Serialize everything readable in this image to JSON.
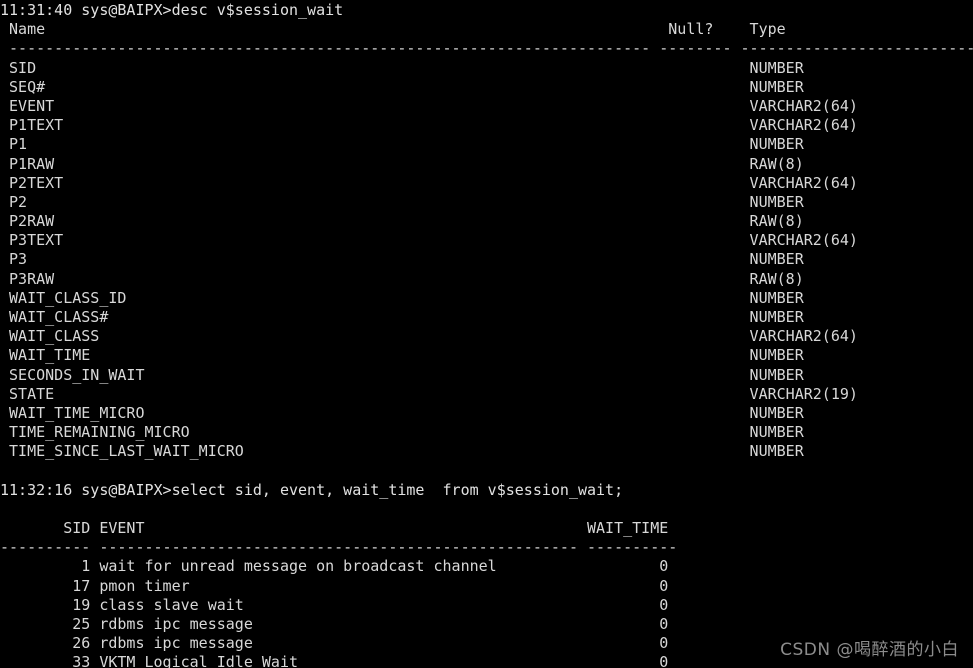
{
  "terminal": {
    "background_color": "#000000",
    "foreground_color": "#d8d8d8",
    "watermark": "CSDN @喝醉酒的小白"
  },
  "session": {
    "prompt_1": "11:31:40 sys@BAIPX>desc v$session_wait",
    "prompt_2": "11:32:16 sys@BAIPX>select sid, event, wait_time  from v$session_wait;",
    "timestamps": [
      "11:31:40",
      "11:32:16"
    ],
    "user_host": "sys@BAIPX",
    "commands": [
      "desc v$session_wait",
      "select sid, event, wait_time  from v$session_wait;"
    ]
  },
  "describe_table": {
    "headers": [
      " Name",
      "Null?",
      "Type"
    ],
    "header_line": " Name                                                                     Null?    Type",
    "separator_line": " ----------------------------------------------------------------------- -------- -----------------------------",
    "columns": [
      {
        "name": "SID",
        "null": "",
        "type": "NUMBER"
      },
      {
        "name": "SEQ#",
        "null": "",
        "type": "NUMBER"
      },
      {
        "name": "EVENT",
        "null": "",
        "type": "VARCHAR2(64)"
      },
      {
        "name": "P1TEXT",
        "null": "",
        "type": "VARCHAR2(64)"
      },
      {
        "name": "P1",
        "null": "",
        "type": "NUMBER"
      },
      {
        "name": "P1RAW",
        "null": "",
        "type": "RAW(8)"
      },
      {
        "name": "P2TEXT",
        "null": "",
        "type": "VARCHAR2(64)"
      },
      {
        "name": "P2",
        "null": "",
        "type": "NUMBER"
      },
      {
        "name": "P2RAW",
        "null": "",
        "type": "RAW(8)"
      },
      {
        "name": "P3TEXT",
        "null": "",
        "type": "VARCHAR2(64)"
      },
      {
        "name": "P3",
        "null": "",
        "type": "NUMBER"
      },
      {
        "name": "P3RAW",
        "null": "",
        "type": "RAW(8)"
      },
      {
        "name": "WAIT_CLASS_ID",
        "null": "",
        "type": "NUMBER"
      },
      {
        "name": "WAIT_CLASS#",
        "null": "",
        "type": "NUMBER"
      },
      {
        "name": "WAIT_CLASS",
        "null": "",
        "type": "VARCHAR2(64)"
      },
      {
        "name": "WAIT_TIME",
        "null": "",
        "type": "NUMBER"
      },
      {
        "name": "SECONDS_IN_WAIT",
        "null": "",
        "type": "NUMBER"
      },
      {
        "name": "STATE",
        "null": "",
        "type": "VARCHAR2(19)"
      },
      {
        "name": "WAIT_TIME_MICRO",
        "null": "",
        "type": "NUMBER"
      },
      {
        "name": "TIME_REMAINING_MICRO",
        "null": "",
        "type": "NUMBER"
      },
      {
        "name": "TIME_SINCE_LAST_WAIT_MICRO",
        "null": "",
        "type": "NUMBER"
      }
    ]
  },
  "query_result": {
    "headers": [
      "SID",
      "EVENT",
      "WAIT_TIME"
    ],
    "header_line": "       SID EVENT                                                 WAIT_TIME",
    "separator_line": "---------- ----------------------------------------------------- ----------",
    "rows": [
      {
        "sid": "1",
        "event": "wait for unread message on broadcast channel",
        "wait_time": "0"
      },
      {
        "sid": "17",
        "event": "pmon timer",
        "wait_time": "0"
      },
      {
        "sid": "19",
        "event": "class slave wait",
        "wait_time": "0"
      },
      {
        "sid": "25",
        "event": "rdbms ipc message",
        "wait_time": "0"
      },
      {
        "sid": "26",
        "event": "rdbms ipc message",
        "wait_time": "0"
      },
      {
        "sid": "33",
        "event": "VKTM Logical Idle Wait",
        "wait_time": "0"
      }
    ]
  },
  "rendered_lines": [
    "11:31:40 sys@BAIPX>desc v$session_wait",
    " Name                                                                     Null?    Type",
    " ----------------------------------------------------------------------- -------- -----------------------------",
    " SID                                                                               NUMBER",
    " SEQ#                                                                              NUMBER",
    " EVENT                                                                             VARCHAR2(64)",
    " P1TEXT                                                                            VARCHAR2(64)",
    " P1                                                                                NUMBER",
    " P1RAW                                                                             RAW(8)",
    " P2TEXT                                                                            VARCHAR2(64)",
    " P2                                                                                NUMBER",
    " P2RAW                                                                             RAW(8)",
    " P3TEXT                                                                            VARCHAR2(64)",
    " P3                                                                                NUMBER",
    " P3RAW                                                                             RAW(8)",
    " WAIT_CLASS_ID                                                                     NUMBER",
    " WAIT_CLASS#                                                                       NUMBER",
    " WAIT_CLASS                                                                        VARCHAR2(64)",
    " WAIT_TIME                                                                         NUMBER",
    " SECONDS_IN_WAIT                                                                   NUMBER",
    " STATE                                                                             VARCHAR2(19)",
    " WAIT_TIME_MICRO                                                                   NUMBER",
    " TIME_REMAINING_MICRO                                                              NUMBER",
    " TIME_SINCE_LAST_WAIT_MICRO                                                        NUMBER",
    "",
    "11:32:16 sys@BAIPX>select sid, event, wait_time  from v$session_wait;",
    "",
    "       SID EVENT                                                 WAIT_TIME",
    "---------- ----------------------------------------------------- ----------",
    "         1 wait for unread message on broadcast channel                  0",
    "        17 pmon timer                                                    0",
    "        19 class slave wait                                              0",
    "        25 rdbms ipc message                                             0",
    "        26 rdbms ipc message                                             0",
    "        33 VKTM Logical Idle Wait                                        0"
  ]
}
